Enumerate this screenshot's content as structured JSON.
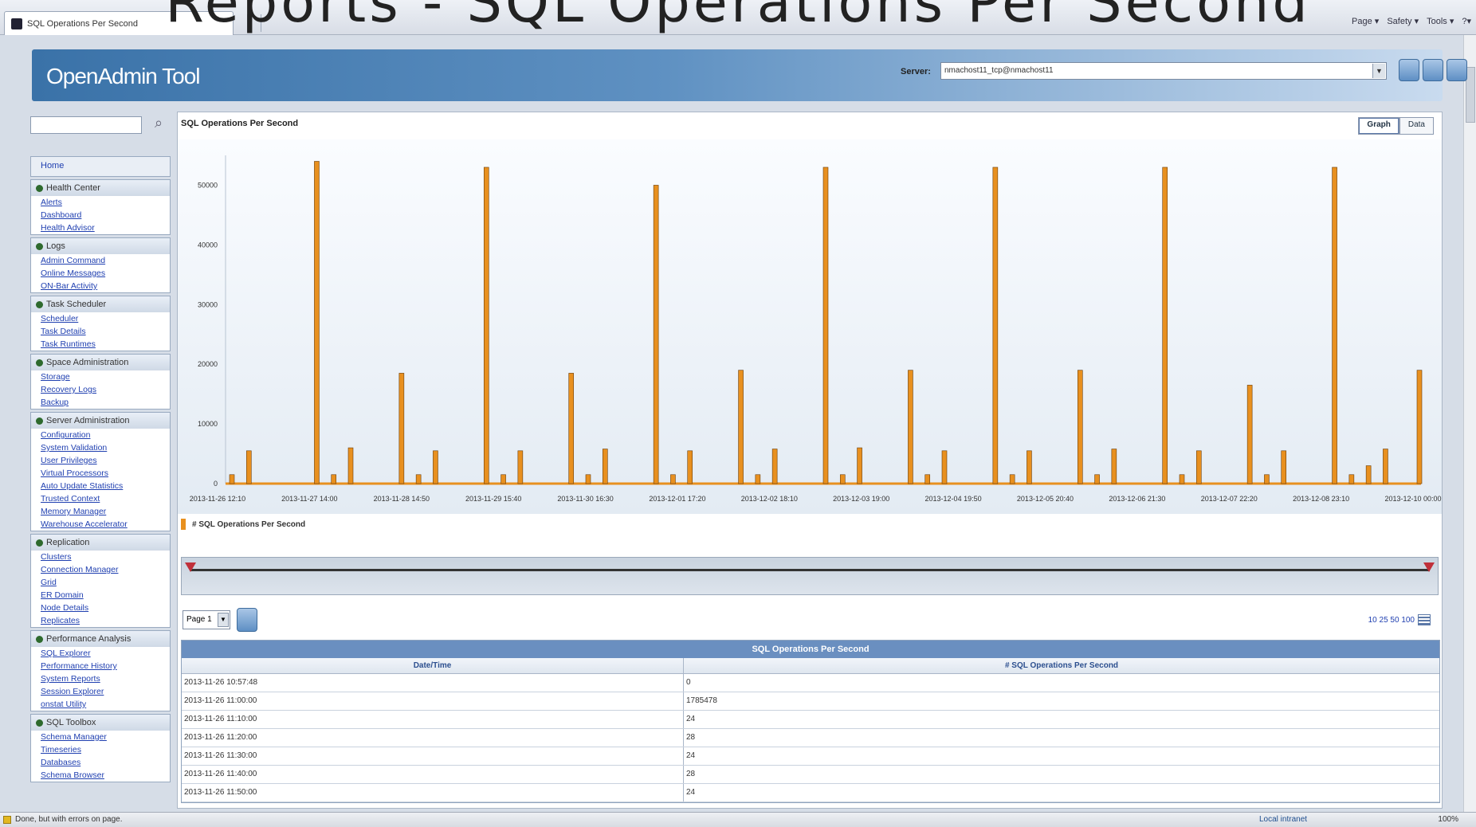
{
  "banner": "Reports - SQL Operations Per Second",
  "browser": {
    "tab_title": "SQL Operations Per Second",
    "commands": [
      "Page ▾",
      "Safety ▾",
      "Tools ▾",
      "?▾"
    ]
  },
  "header": {
    "logo": "OpenAdmin Tool",
    "server_label": "Server:",
    "server_value": "nmachost11_tcp@nmachost11"
  },
  "sidebar": {
    "home": "Home",
    "sections": [
      {
        "title": "Health Center",
        "items": [
          "Alerts",
          "Dashboard",
          "Health Advisor"
        ]
      },
      {
        "title": "Logs",
        "items": [
          "Admin Command",
          "Online Messages",
          "ON-Bar Activity"
        ]
      },
      {
        "title": "Task Scheduler",
        "items": [
          "Scheduler",
          "Task Details",
          "Task Runtimes"
        ]
      },
      {
        "title": "Space Administration",
        "items": [
          "Storage",
          "Recovery Logs",
          "Backup"
        ]
      },
      {
        "title": "Server Administration",
        "items": [
          "Configuration",
          "System Validation",
          "User Privileges",
          "Virtual Processors",
          "Auto Update Statistics",
          "Trusted Context",
          "Memory Manager",
          "Warehouse Accelerator"
        ]
      },
      {
        "title": "Replication",
        "items": [
          "Clusters",
          "Connection Manager",
          "Grid",
          "ER Domain",
          "Node Details",
          "Replicates"
        ]
      },
      {
        "title": "Performance Analysis",
        "items": [
          "SQL Explorer",
          "Performance History",
          "System Reports",
          "Session Explorer",
          "onstat Utility"
        ]
      },
      {
        "title": "SQL Toolbox",
        "items": [
          "Schema Manager",
          "Timeseries",
          "Databases",
          "Schema Browser"
        ]
      }
    ]
  },
  "chart_title": "SQL Operations Per Second",
  "view_tabs": [
    "Graph",
    "Data"
  ],
  "colors": {
    "bar": "#e8901f",
    "accent": "#6a8fc0"
  },
  "chart_data": {
    "type": "bar",
    "title": "SQL Operations Per Second",
    "xlabel": "",
    "ylabel": "",
    "ylim": [
      0,
      55000
    ],
    "yticks": [
      0,
      10000,
      20000,
      30000,
      40000,
      50000
    ],
    "xtick_labels": [
      "2013-11-26 12:10",
      "2013-11-27 14:00",
      "2013-11-28 14:50",
      "2013-11-29 15:40",
      "2013-11-30 16:30",
      "2013-12-01 17:20",
      "2013-12-02 18:10",
      "2013-12-03 19:00",
      "2013-12-04 19:50",
      "2013-12-05 20:40",
      "2013-12-06 21:30",
      "2013-12-07 22:20",
      "2013-12-08 23:10",
      "2013-12-10 00:00"
    ],
    "series": [
      {
        "name": "# SQL Operations Per Second",
        "values": [
          1500,
          5500,
          0,
          0,
          0,
          54000,
          1500,
          6000,
          0,
          0,
          18500,
          1500,
          5500,
          0,
          0,
          53000,
          1500,
          5500,
          0,
          0,
          18500,
          1500,
          5800,
          0,
          0,
          50000,
          1500,
          5500,
          0,
          0,
          19000,
          1500,
          5800,
          0,
          0,
          53000,
          1500,
          6000,
          0,
          0,
          19000,
          1500,
          5500,
          0,
          0,
          53000,
          1500,
          5500,
          0,
          0,
          19000,
          1500,
          5800,
          0,
          0,
          53000,
          1500,
          5500,
          0,
          0,
          16500,
          1500,
          5500,
          0,
          0,
          53000,
          1500,
          3000,
          5800,
          0,
          19000
        ]
      }
    ]
  },
  "legend": "# SQL Operations Per Second",
  "pager": {
    "select": "Page 1",
    "per_page": "10 25 50 100"
  },
  "grid": {
    "caption": "SQL Operations Per Second",
    "columns": [
      "Date/Time",
      "# SQL Operations Per Second"
    ],
    "rows": [
      [
        "2013-11-26 10:57:48",
        "0"
      ],
      [
        "2013-11-26 11:00:00",
        "1785478"
      ],
      [
        "2013-11-26 11:10:00",
        "24"
      ],
      [
        "2013-11-26 11:20:00",
        "28"
      ],
      [
        "2013-11-26 11:30:00",
        "24"
      ],
      [
        "2013-11-26 11:40:00",
        "28"
      ],
      [
        "2013-11-26 11:50:00",
        "24"
      ]
    ]
  },
  "status": {
    "left": "Done, but with errors on page.",
    "zone": "Local intranet",
    "zoom": "100%"
  }
}
